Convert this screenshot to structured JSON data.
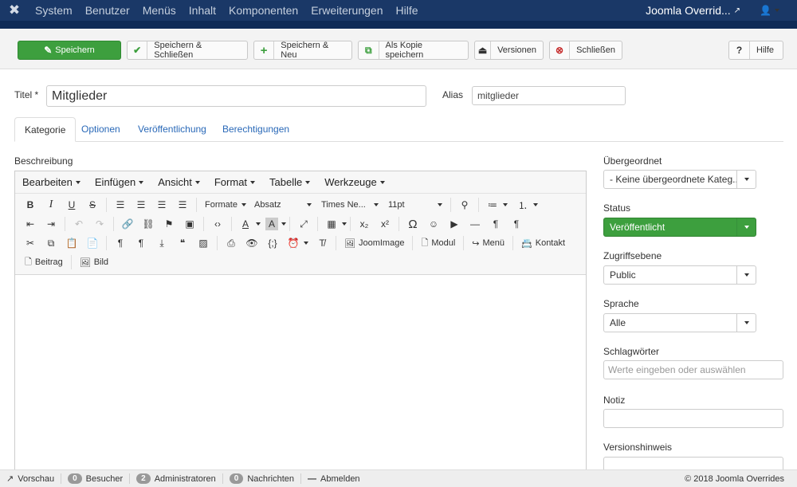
{
  "topnav": {
    "logo_icon": "joomla-logo-icon",
    "menu": [
      "System",
      "Benutzer",
      "Menüs",
      "Inhalt",
      "Komponenten",
      "Erweiterungen",
      "Hilfe"
    ],
    "site_name": "Joomla Overrid...",
    "user_icon": "user-icon"
  },
  "toolbar": {
    "save": "Speichern",
    "save_close": "Speichern & Schließen",
    "save_new": "Speichern & Neu",
    "save_copy": "Als Kopie speichern",
    "versions": "Versionen",
    "close": "Schließen",
    "help": "Hilfe"
  },
  "form": {
    "title_label": "Titel *",
    "title_value": "Mitglieder",
    "alias_label": "Alias",
    "alias_value": "mitglieder"
  },
  "tabs": [
    "Kategorie",
    "Optionen",
    "Veröffentlichung",
    "Berechtigungen"
  ],
  "editor": {
    "label": "Beschreibung",
    "menubar": [
      "Bearbeiten",
      "Einfügen",
      "Ansicht",
      "Format",
      "Tabelle",
      "Werkzeuge"
    ],
    "formats": "Formate",
    "block": "Absatz",
    "font": "Times Ne...",
    "size": "11pt",
    "joomimage": "JoomImage",
    "modul": "Modul",
    "menu": "Menü",
    "kontakt": "Kontakt",
    "beitrag": "Beitrag",
    "bild": "Bild"
  },
  "side": {
    "parent_label": "Übergeordnet",
    "parent_value": "- Keine übergeordnete Kateg...",
    "status_label": "Status",
    "status_value": "Veröffentlicht",
    "access_label": "Zugriffsebene",
    "access_value": "Public",
    "language_label": "Sprache",
    "language_value": "Alle",
    "tags_label": "Schlagwörter",
    "tags_placeholder": "Werte eingeben oder auswählen",
    "note_label": "Notiz",
    "note_value": "",
    "version_label": "Versionshinweis"
  },
  "statusbar": {
    "preview": "Vorschau",
    "visitors_count": "0",
    "visitors": "Besucher",
    "admins_count": "2",
    "admins": "Administratoren",
    "messages_count": "0",
    "messages": "Nachrichten",
    "logout": "Abmelden",
    "copyright": "© 2018 Joomla Overrides"
  },
  "colors": {
    "nav": "#1a3867",
    "primary": "#3d9f3e",
    "link": "#2a69b8"
  }
}
